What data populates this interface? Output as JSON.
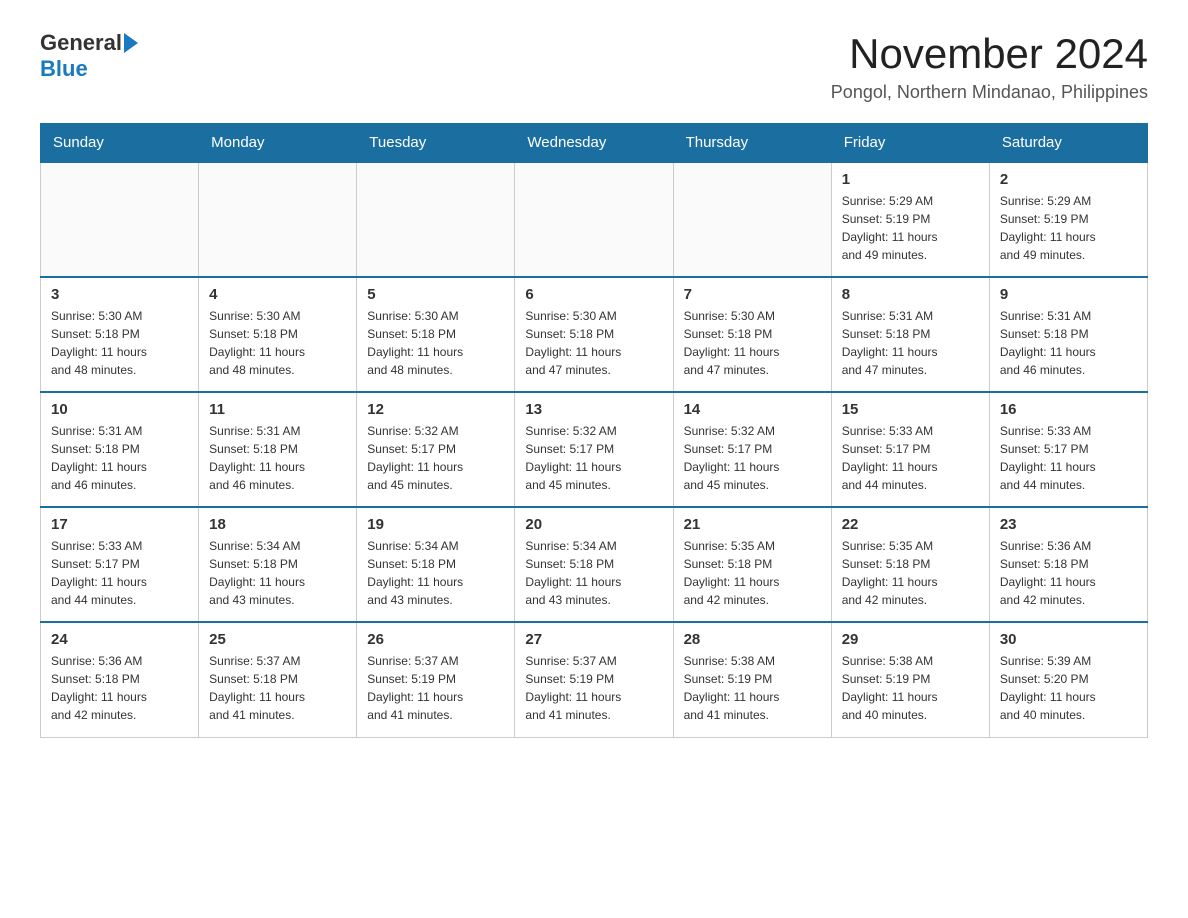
{
  "logo": {
    "general": "General",
    "blue": "Blue"
  },
  "title": "November 2024",
  "subtitle": "Pongol, Northern Mindanao, Philippines",
  "weekdays": [
    "Sunday",
    "Monday",
    "Tuesday",
    "Wednesday",
    "Thursday",
    "Friday",
    "Saturday"
  ],
  "weeks": [
    [
      {
        "day": "",
        "info": ""
      },
      {
        "day": "",
        "info": ""
      },
      {
        "day": "",
        "info": ""
      },
      {
        "day": "",
        "info": ""
      },
      {
        "day": "",
        "info": ""
      },
      {
        "day": "1",
        "info": "Sunrise: 5:29 AM\nSunset: 5:19 PM\nDaylight: 11 hours\nand 49 minutes."
      },
      {
        "day": "2",
        "info": "Sunrise: 5:29 AM\nSunset: 5:19 PM\nDaylight: 11 hours\nand 49 minutes."
      }
    ],
    [
      {
        "day": "3",
        "info": "Sunrise: 5:30 AM\nSunset: 5:18 PM\nDaylight: 11 hours\nand 48 minutes."
      },
      {
        "day": "4",
        "info": "Sunrise: 5:30 AM\nSunset: 5:18 PM\nDaylight: 11 hours\nand 48 minutes."
      },
      {
        "day": "5",
        "info": "Sunrise: 5:30 AM\nSunset: 5:18 PM\nDaylight: 11 hours\nand 48 minutes."
      },
      {
        "day": "6",
        "info": "Sunrise: 5:30 AM\nSunset: 5:18 PM\nDaylight: 11 hours\nand 47 minutes."
      },
      {
        "day": "7",
        "info": "Sunrise: 5:30 AM\nSunset: 5:18 PM\nDaylight: 11 hours\nand 47 minutes."
      },
      {
        "day": "8",
        "info": "Sunrise: 5:31 AM\nSunset: 5:18 PM\nDaylight: 11 hours\nand 47 minutes."
      },
      {
        "day": "9",
        "info": "Sunrise: 5:31 AM\nSunset: 5:18 PM\nDaylight: 11 hours\nand 46 minutes."
      }
    ],
    [
      {
        "day": "10",
        "info": "Sunrise: 5:31 AM\nSunset: 5:18 PM\nDaylight: 11 hours\nand 46 minutes."
      },
      {
        "day": "11",
        "info": "Sunrise: 5:31 AM\nSunset: 5:18 PM\nDaylight: 11 hours\nand 46 minutes."
      },
      {
        "day": "12",
        "info": "Sunrise: 5:32 AM\nSunset: 5:17 PM\nDaylight: 11 hours\nand 45 minutes."
      },
      {
        "day": "13",
        "info": "Sunrise: 5:32 AM\nSunset: 5:17 PM\nDaylight: 11 hours\nand 45 minutes."
      },
      {
        "day": "14",
        "info": "Sunrise: 5:32 AM\nSunset: 5:17 PM\nDaylight: 11 hours\nand 45 minutes."
      },
      {
        "day": "15",
        "info": "Sunrise: 5:33 AM\nSunset: 5:17 PM\nDaylight: 11 hours\nand 44 minutes."
      },
      {
        "day": "16",
        "info": "Sunrise: 5:33 AM\nSunset: 5:17 PM\nDaylight: 11 hours\nand 44 minutes."
      }
    ],
    [
      {
        "day": "17",
        "info": "Sunrise: 5:33 AM\nSunset: 5:17 PM\nDaylight: 11 hours\nand 44 minutes."
      },
      {
        "day": "18",
        "info": "Sunrise: 5:34 AM\nSunset: 5:18 PM\nDaylight: 11 hours\nand 43 minutes."
      },
      {
        "day": "19",
        "info": "Sunrise: 5:34 AM\nSunset: 5:18 PM\nDaylight: 11 hours\nand 43 minutes."
      },
      {
        "day": "20",
        "info": "Sunrise: 5:34 AM\nSunset: 5:18 PM\nDaylight: 11 hours\nand 43 minutes."
      },
      {
        "day": "21",
        "info": "Sunrise: 5:35 AM\nSunset: 5:18 PM\nDaylight: 11 hours\nand 42 minutes."
      },
      {
        "day": "22",
        "info": "Sunrise: 5:35 AM\nSunset: 5:18 PM\nDaylight: 11 hours\nand 42 minutes."
      },
      {
        "day": "23",
        "info": "Sunrise: 5:36 AM\nSunset: 5:18 PM\nDaylight: 11 hours\nand 42 minutes."
      }
    ],
    [
      {
        "day": "24",
        "info": "Sunrise: 5:36 AM\nSunset: 5:18 PM\nDaylight: 11 hours\nand 42 minutes."
      },
      {
        "day": "25",
        "info": "Sunrise: 5:37 AM\nSunset: 5:18 PM\nDaylight: 11 hours\nand 41 minutes."
      },
      {
        "day": "26",
        "info": "Sunrise: 5:37 AM\nSunset: 5:19 PM\nDaylight: 11 hours\nand 41 minutes."
      },
      {
        "day": "27",
        "info": "Sunrise: 5:37 AM\nSunset: 5:19 PM\nDaylight: 11 hours\nand 41 minutes."
      },
      {
        "day": "28",
        "info": "Sunrise: 5:38 AM\nSunset: 5:19 PM\nDaylight: 11 hours\nand 41 minutes."
      },
      {
        "day": "29",
        "info": "Sunrise: 5:38 AM\nSunset: 5:19 PM\nDaylight: 11 hours\nand 40 minutes."
      },
      {
        "day": "30",
        "info": "Sunrise: 5:39 AM\nSunset: 5:20 PM\nDaylight: 11 hours\nand 40 minutes."
      }
    ]
  ]
}
